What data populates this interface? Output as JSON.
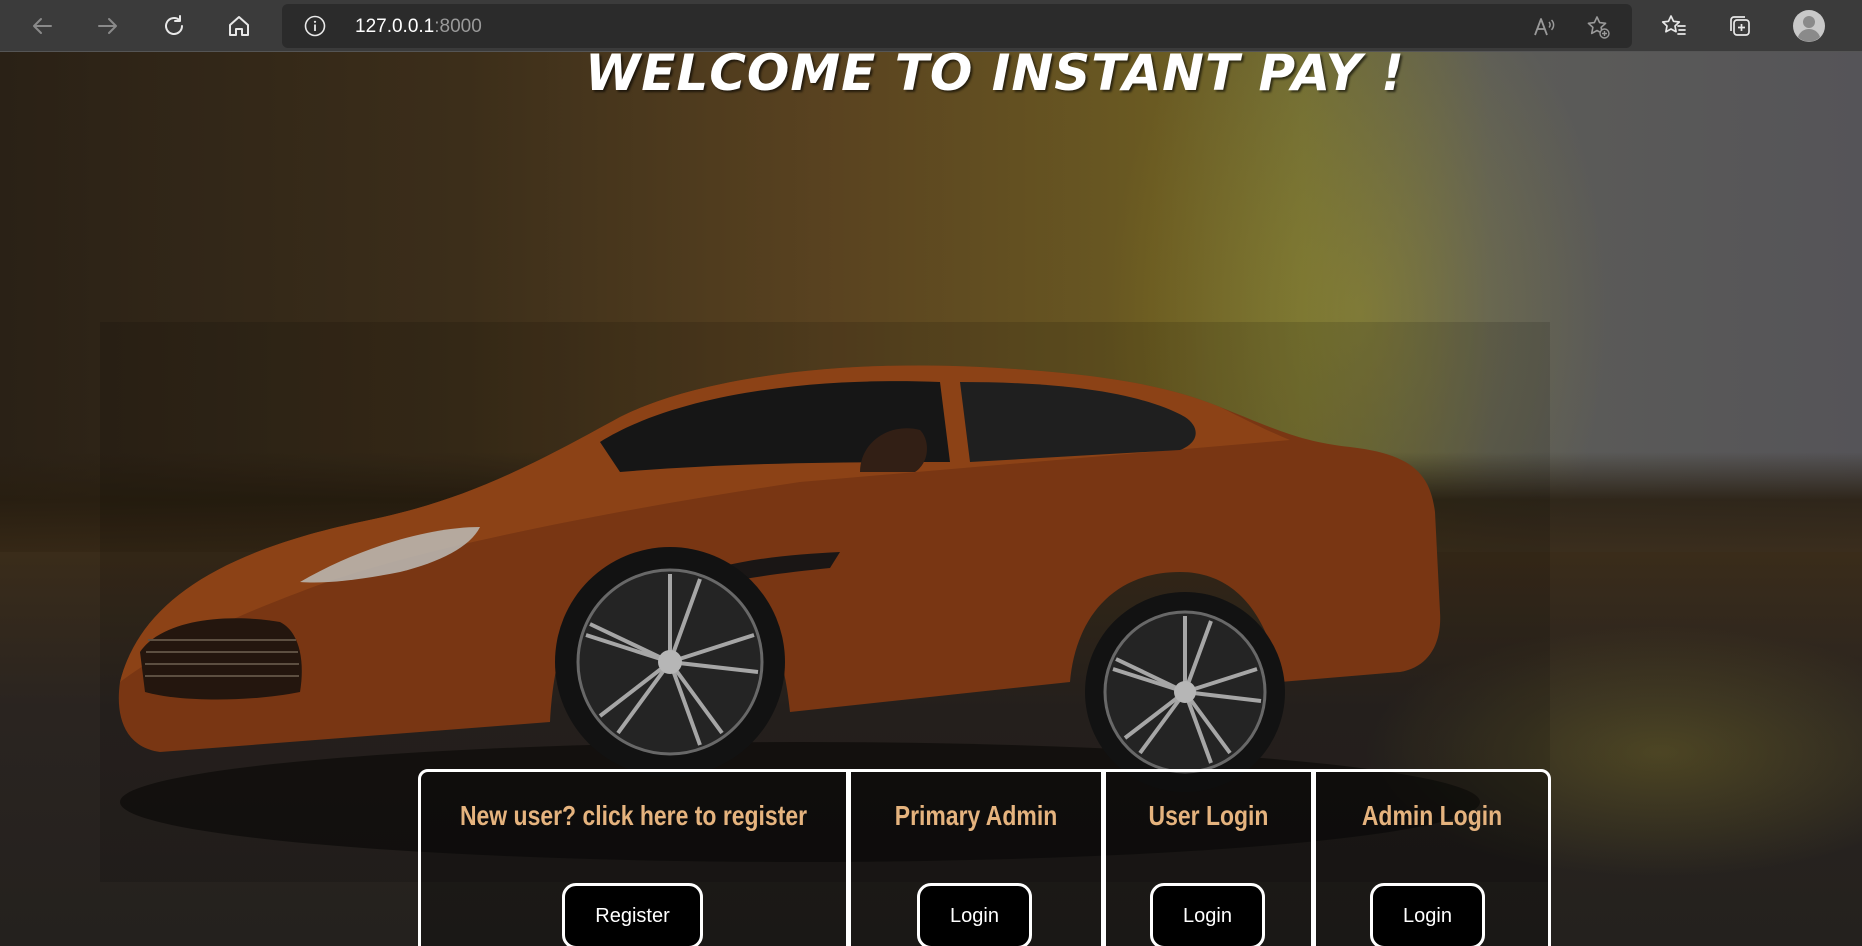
{
  "browser": {
    "url_host": "127.0.0.1",
    "url_port": ":8000",
    "icons": {
      "back": "back-arrow-icon",
      "forward": "forward-arrow-icon",
      "refresh": "refresh-icon",
      "home": "home-icon",
      "info": "site-info-icon",
      "read_aloud": "read-aloud-icon",
      "add_favorite": "add-favorite-icon",
      "favorites": "favorites-icon",
      "collections": "collections-icon",
      "profile": "profile-avatar-icon"
    }
  },
  "page": {
    "welcome": "WELCOME TO INSTANT PAY !",
    "options": [
      {
        "title": "New user? click here to register",
        "button": "Register"
      },
      {
        "title": "Primary Admin",
        "button": "Login"
      },
      {
        "title": "User Login",
        "button": "Login"
      },
      {
        "title": "Admin Login",
        "button": "Login"
      }
    ],
    "colors": {
      "option_title": "#e5b37e",
      "button_bg": "#000000",
      "panel_border": "#ffffff"
    }
  }
}
